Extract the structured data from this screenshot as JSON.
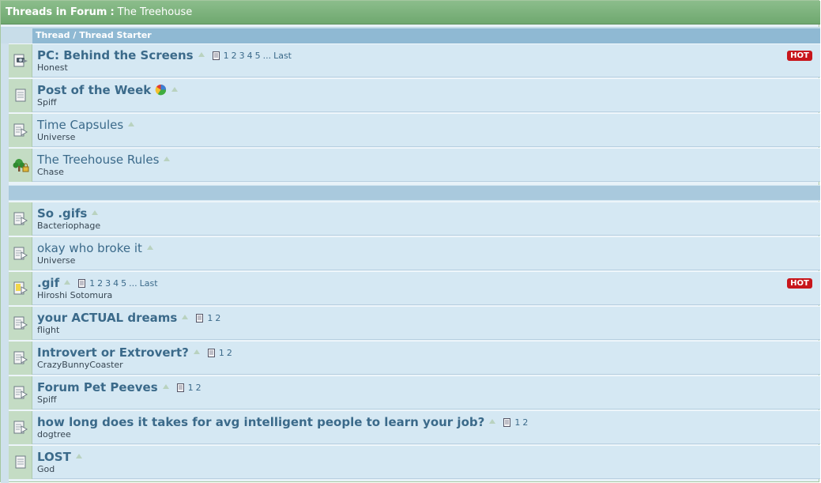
{
  "header": {
    "prefix": "Threads in Forum",
    "separator": ":",
    "forum_name": "The Treehouse"
  },
  "columns": {
    "thread_label": "Thread / Thread Starter"
  },
  "sticky_threads": [
    {
      "title": "PC: Behind the Screens",
      "starter": "Honest",
      "bold": true,
      "icon": "camera-thread-icon",
      "pages": [
        "1",
        "2",
        "3",
        "4",
        "5",
        "...",
        "Last"
      ],
      "hot": "HOT",
      "poll": false
    },
    {
      "title": "Post of the Week",
      "starter": "Spiff",
      "bold": true,
      "icon": "document-thread-icon",
      "pages": [],
      "hot": "",
      "poll": true
    },
    {
      "title": "Time Capsules",
      "starter": "Universe",
      "bold": false,
      "icon": "arrow-document-thread-icon",
      "pages": [],
      "hot": "",
      "poll": false
    },
    {
      "title": "The Treehouse Rules",
      "starter": "Chase",
      "bold": false,
      "icon": "tree-lock-thread-icon",
      "pages": [],
      "hot": "",
      "poll": false
    }
  ],
  "normal_threads": [
    {
      "title": "So .gifs",
      "starter": "Bacteriophage",
      "bold": true,
      "icon": "arrow-document-thread-icon",
      "pages": [],
      "hot": ""
    },
    {
      "title": "okay who broke it",
      "starter": "Universe",
      "bold": false,
      "icon": "arrow-document-thread-icon",
      "pages": [],
      "hot": ""
    },
    {
      "title": ".gif",
      "starter": "Hiroshi Sotomura",
      "bold": true,
      "icon": "yellow-arrow-document-thread-icon",
      "pages": [
        "1",
        "2",
        "3",
        "4",
        "5",
        "...",
        "Last"
      ],
      "hot": "HOT"
    },
    {
      "title": "your ACTUAL dreams",
      "starter": "flight",
      "bold": true,
      "icon": "arrow-document-thread-icon",
      "pages": [
        "1",
        "2"
      ],
      "hot": ""
    },
    {
      "title": "Introvert or Extrovert?",
      "starter": "CrazyBunnyCoaster",
      "bold": true,
      "icon": "arrow-document-thread-icon",
      "pages": [
        "1",
        "2"
      ],
      "hot": ""
    },
    {
      "title": "Forum Pet Peeves",
      "starter": "Spiff",
      "bold": true,
      "icon": "arrow-document-thread-icon",
      "pages": [
        "1",
        "2"
      ],
      "hot": ""
    },
    {
      "title": "how long does it takes for avg intelligent people to learn your job?",
      "starter": "dogtree",
      "bold": true,
      "icon": "arrow-document-thread-icon",
      "pages": [
        "1",
        "2"
      ],
      "hot": ""
    },
    {
      "title": "LOST",
      "starter": "God",
      "bold": true,
      "icon": "document-thread-icon",
      "pages": [],
      "hot": ""
    }
  ],
  "colors": {
    "title_bar": "#7db37d",
    "column_header": "#8fb9d3",
    "row_bg": "#d5e8f3",
    "link": "#3b6a8a",
    "hot_badge": "#c8161b"
  }
}
